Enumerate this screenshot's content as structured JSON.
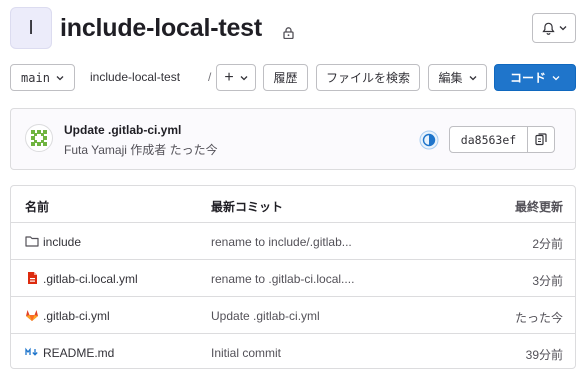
{
  "project": {
    "avatar_letter": "I",
    "title": "include-local-test",
    "lock_icon": "lock-icon"
  },
  "notifications": {
    "icon": "bell-icon"
  },
  "toolbar": {
    "branch": "main",
    "breadcrumb": "include-local-test",
    "breadcrumb_sep": "/",
    "add_label": "+",
    "history_label": "履歴",
    "find_file_label": "ファイルを検索",
    "edit_label": "編集",
    "code_label": "コード"
  },
  "commit": {
    "title": "Update .gitlab-ci.yml",
    "meta": "Futa Yamaji 作成者 たった今",
    "sha": "da8563ef",
    "pipeline_icon": "pipeline-status-running-icon",
    "copy_icon": "copy-icon"
  },
  "files": {
    "headers": {
      "name": "名前",
      "commit": "最新コミット",
      "date": "最終更新"
    },
    "rows": [
      {
        "icon": "folder-icon",
        "name": "include",
        "commit": "rename to include/.gitlab...",
        "date": "2分前"
      },
      {
        "icon": "yaml-file-icon",
        "name": ".gitlab-ci.local.yml",
        "commit": "rename to .gitlab-ci.local....",
        "date": "3分前"
      },
      {
        "icon": "gitlab-ci-icon",
        "name": ".gitlab-ci.yml",
        "commit": "Update .gitlab-ci.yml",
        "date": "たった今"
      },
      {
        "icon": "markdown-icon",
        "name": "README.md",
        "commit": "Initial commit",
        "date": "39分前"
      }
    ]
  },
  "colors": {
    "primary": "#1f75cb",
    "yaml_red": "#dd2b0e",
    "gitlab_orange": "#e24329",
    "markdown_blue": "#1f75cb",
    "pipeline_blue": "#1f75cb"
  }
}
